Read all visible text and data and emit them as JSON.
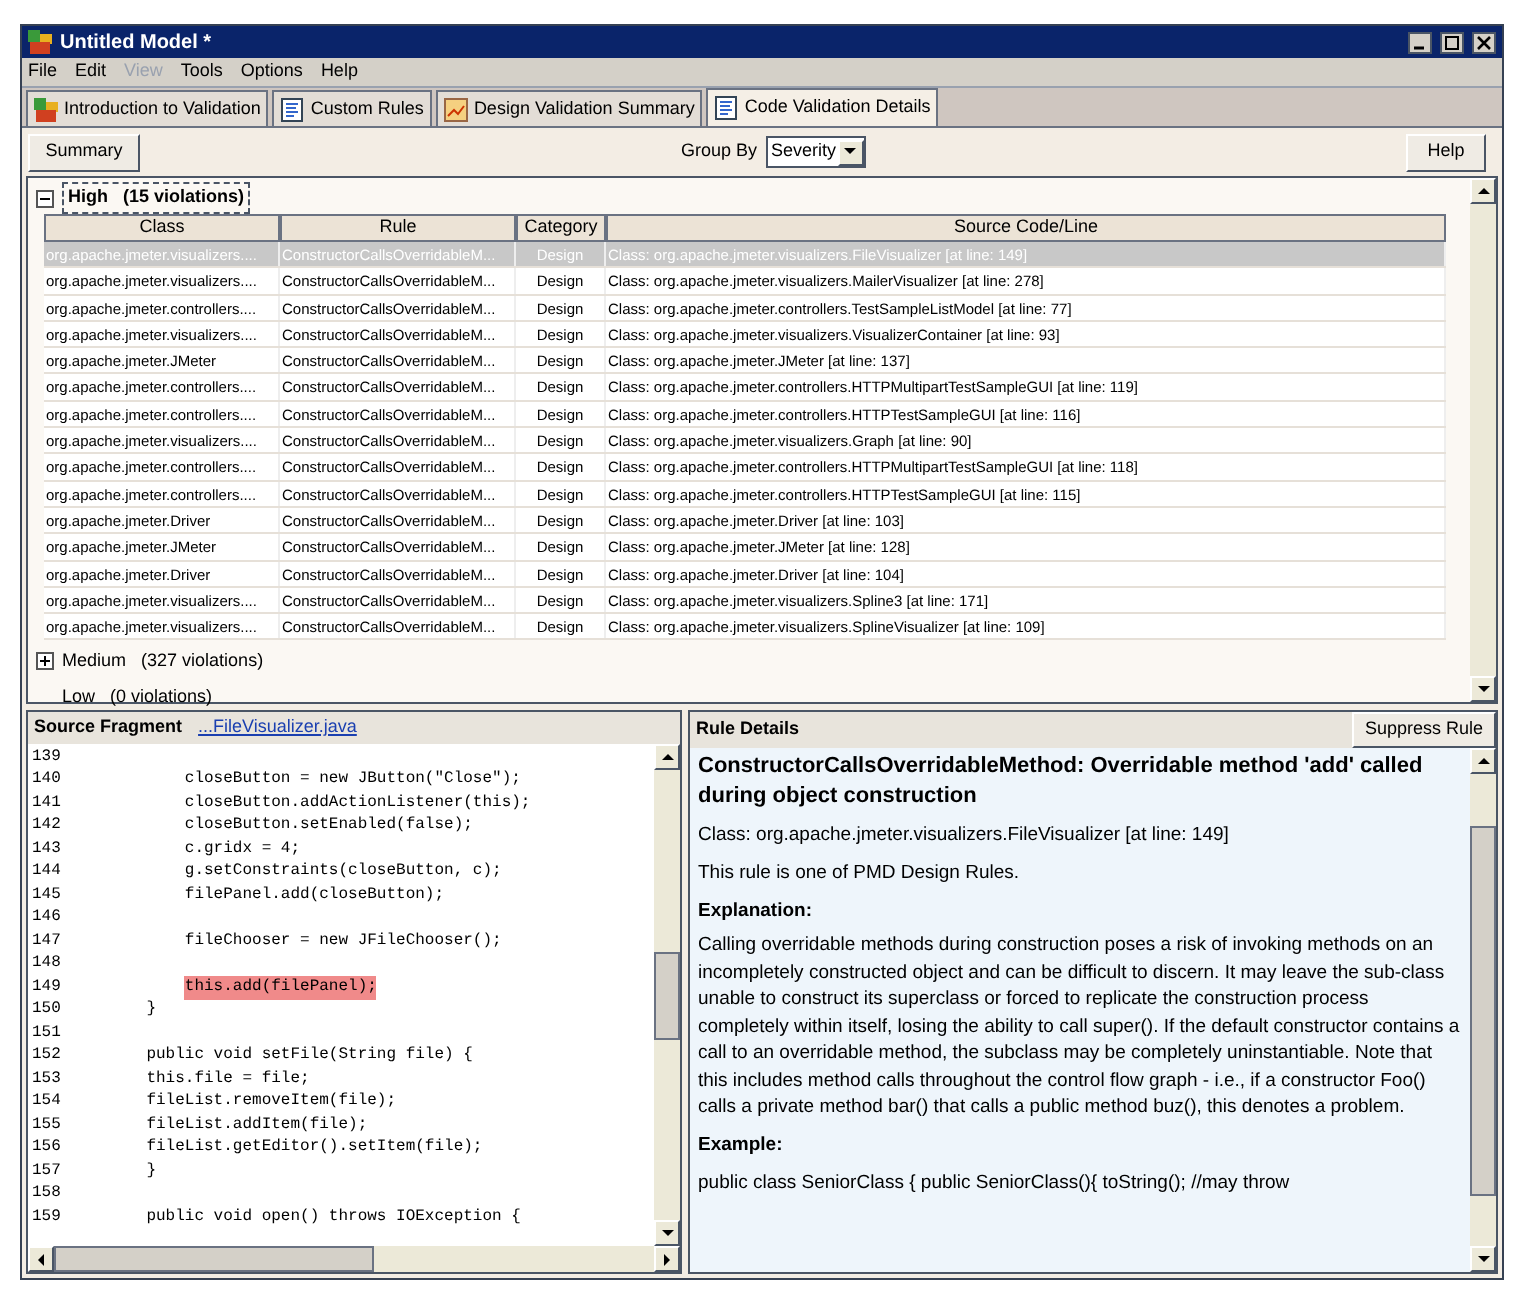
{
  "window": {
    "title": "Untitled Model *"
  },
  "menu": [
    {
      "label": "File",
      "disabled": false
    },
    {
      "label": "Edit",
      "disabled": false
    },
    {
      "label": "View",
      "disabled": true
    },
    {
      "label": "Tools",
      "disabled": false
    },
    {
      "label": "Options",
      "disabled": false
    },
    {
      "label": "Help",
      "disabled": false
    }
  ],
  "tabs": [
    {
      "label": "Introduction to Validation",
      "selected": false
    },
    {
      "label": "Custom Rules",
      "selected": false
    },
    {
      "label": "Design Validation Summary",
      "selected": false
    },
    {
      "label": "Code Validation Details",
      "selected": true
    }
  ],
  "toolbar": {
    "summary_button": "Summary",
    "group_by_label": "Group By",
    "group_by_value": "Severity",
    "help_button": "Help"
  },
  "table": {
    "columns": [
      "Class",
      "Rule",
      "Category",
      "Source Code/Line"
    ],
    "groups": [
      {
        "label": "High",
        "count": "(15 violations)",
        "expanded": true,
        "rows": [
          {
            "cells": [
              "org.apache.jmeter.visualizers....",
              "ConstructorCallsOverridableM...",
              "Design",
              "Class: org.apache.jmeter.visualizers.FileVisualizer [at line: 149]"
            ],
            "selected": true
          },
          {
            "cells": [
              "org.apache.jmeter.visualizers....",
              "ConstructorCallsOverridableM...",
              "Design",
              "Class: org.apache.jmeter.visualizers.MailerVisualizer [at line: 278]"
            ],
            "selected": false
          },
          {
            "cells": [
              "org.apache.jmeter.controllers....",
              "ConstructorCallsOverridableM...",
              "Design",
              "Class: org.apache.jmeter.controllers.TestSampleListModel [at line: 77]"
            ],
            "selected": false
          },
          {
            "cells": [
              "org.apache.jmeter.visualizers....",
              "ConstructorCallsOverridableM...",
              "Design",
              "Class: org.apache.jmeter.visualizers.VisualizerContainer [at line: 93]"
            ],
            "selected": false
          },
          {
            "cells": [
              "org.apache.jmeter.JMeter",
              "ConstructorCallsOverridableM...",
              "Design",
              "Class: org.apache.jmeter.JMeter [at line: 137]"
            ],
            "selected": false
          },
          {
            "cells": [
              "org.apache.jmeter.controllers....",
              "ConstructorCallsOverridableM...",
              "Design",
              "Class: org.apache.jmeter.controllers.HTTPMultipartTestSampleGUI [at line: 119]"
            ],
            "selected": false
          },
          {
            "cells": [
              "org.apache.jmeter.controllers....",
              "ConstructorCallsOverridableM...",
              "Design",
              "Class: org.apache.jmeter.controllers.HTTPTestSampleGUI [at line: 116]"
            ],
            "selected": false
          },
          {
            "cells": [
              "org.apache.jmeter.visualizers....",
              "ConstructorCallsOverridableM...",
              "Design",
              "Class: org.apache.jmeter.visualizers.Graph [at line: 90]"
            ],
            "selected": false
          },
          {
            "cells": [
              "org.apache.jmeter.controllers....",
              "ConstructorCallsOverridableM...",
              "Design",
              "Class: org.apache.jmeter.controllers.HTTPMultipartTestSampleGUI [at line: 118]"
            ],
            "selected": false
          },
          {
            "cells": [
              "org.apache.jmeter.controllers....",
              "ConstructorCallsOverridableM...",
              "Design",
              "Class: org.apache.jmeter.controllers.HTTPTestSampleGUI [at line: 115]"
            ],
            "selected": false
          },
          {
            "cells": [
              "org.apache.jmeter.Driver",
              "ConstructorCallsOverridableM...",
              "Design",
              "Class: org.apache.jmeter.Driver [at line: 103]"
            ],
            "selected": false
          },
          {
            "cells": [
              "org.apache.jmeter.JMeter",
              "ConstructorCallsOverridableM...",
              "Design",
              "Class: org.apache.jmeter.JMeter [at line: 128]"
            ],
            "selected": false
          },
          {
            "cells": [
              "org.apache.jmeter.Driver",
              "ConstructorCallsOverridableM...",
              "Design",
              "Class: org.apache.jmeter.Driver [at line: 104]"
            ],
            "selected": false
          },
          {
            "cells": [
              "org.apache.jmeter.visualizers....",
              "ConstructorCallsOverridableM...",
              "Design",
              "Class: org.apache.jmeter.visualizers.Spline3 [at line: 171]"
            ],
            "selected": false
          },
          {
            "cells": [
              "org.apache.jmeter.visualizers....",
              "ConstructorCallsOverridableM...",
              "Design",
              "Class: org.apache.jmeter.visualizers.SplineVisualizer [at line: 109]"
            ],
            "selected": false
          }
        ]
      },
      {
        "label": "Medium",
        "count": "(327 violations)",
        "expanded": false
      },
      {
        "label": "Low",
        "count": "(0 violations)"
      }
    ]
  },
  "source_fragment": {
    "title": "Source Fragment",
    "file_link": "...FileVisualizer.java",
    "lines": [
      {
        "number": "139"
      },
      {
        "number": "140",
        "code": "        closeButton = new JButton(\"Close\");",
        "highlighted": false
      },
      {
        "number": "141",
        "code": "        closeButton.addActionListener(this);",
        "highlighted": false
      },
      {
        "number": "142",
        "code": "        closeButton.setEnabled(false);",
        "highlighted": false
      },
      {
        "number": "143",
        "code": "        c.gridx = 4;",
        "highlighted": false
      },
      {
        "number": "144",
        "code": "        g.setConstraints(closeButton, c);",
        "highlighted": false
      },
      {
        "number": "145",
        "code": "        filePanel.add(closeButton);",
        "highlighted": false
      },
      {
        "number": "146"
      },
      {
        "number": "147",
        "code": "        fileChooser = new JFileChooser();",
        "highlighted": false
      },
      {
        "number": "148"
      },
      {
        "number": "149",
        "code": "        this.add(filePanel);",
        "highlighted": true
      },
      {
        "number": "150",
        "code": "    }",
        "highlighted": false
      },
      {
        "number": "151"
      },
      {
        "number": "152",
        "code": "    public void setFile(String file) {",
        "highlighted": false
      },
      {
        "number": "153",
        "code": "    this.file = file;",
        "highlighted": false
      },
      {
        "number": "154",
        "code": "    fileList.removeItem(file);",
        "highlighted": false
      },
      {
        "number": "155",
        "code": "    fileList.addItem(file);",
        "highlighted": false
      },
      {
        "number": "156",
        "code": "    fileList.getEditor().setItem(file);",
        "highlighted": false
      },
      {
        "number": "157",
        "code": "    }",
        "highlighted": false
      },
      {
        "number": "158"
      },
      {
        "number": "159",
        "code": "    public void open() throws IOException {",
        "highlighted": false
      }
    ]
  },
  "rule_details": {
    "title": "Rule Details",
    "suppress_button": "Suppress Rule",
    "heading": "ConstructorCallsOverridableMethod: Overridable method 'add' called during object construction",
    "class_line": "Class: org.apache.jmeter.visualizers.FileVisualizer [at line: 149]",
    "rule_set": "This rule is one of PMD Design Rules.",
    "explanation_heading": "Explanation:",
    "explanation": "Calling overridable methods during construction poses a risk of invoking methods on an incompletely constructed object and can be difficult to discern. It may leave the sub-class unable to construct its superclass or forced to replicate the construction process completely within itself, losing the ability to call super(). If the default constructor contains a call to an overridable method, the subclass may be completely uninstantiable. Note that this includes method calls throughout the control flow graph - i.e., if a constructor Foo() calls a private method bar() that calls a public method buz(), this denotes a problem.",
    "example_heading": "Example:",
    "example": "public class SeniorClass { public SeniorClass(){ toString(); //may throw"
  }
}
